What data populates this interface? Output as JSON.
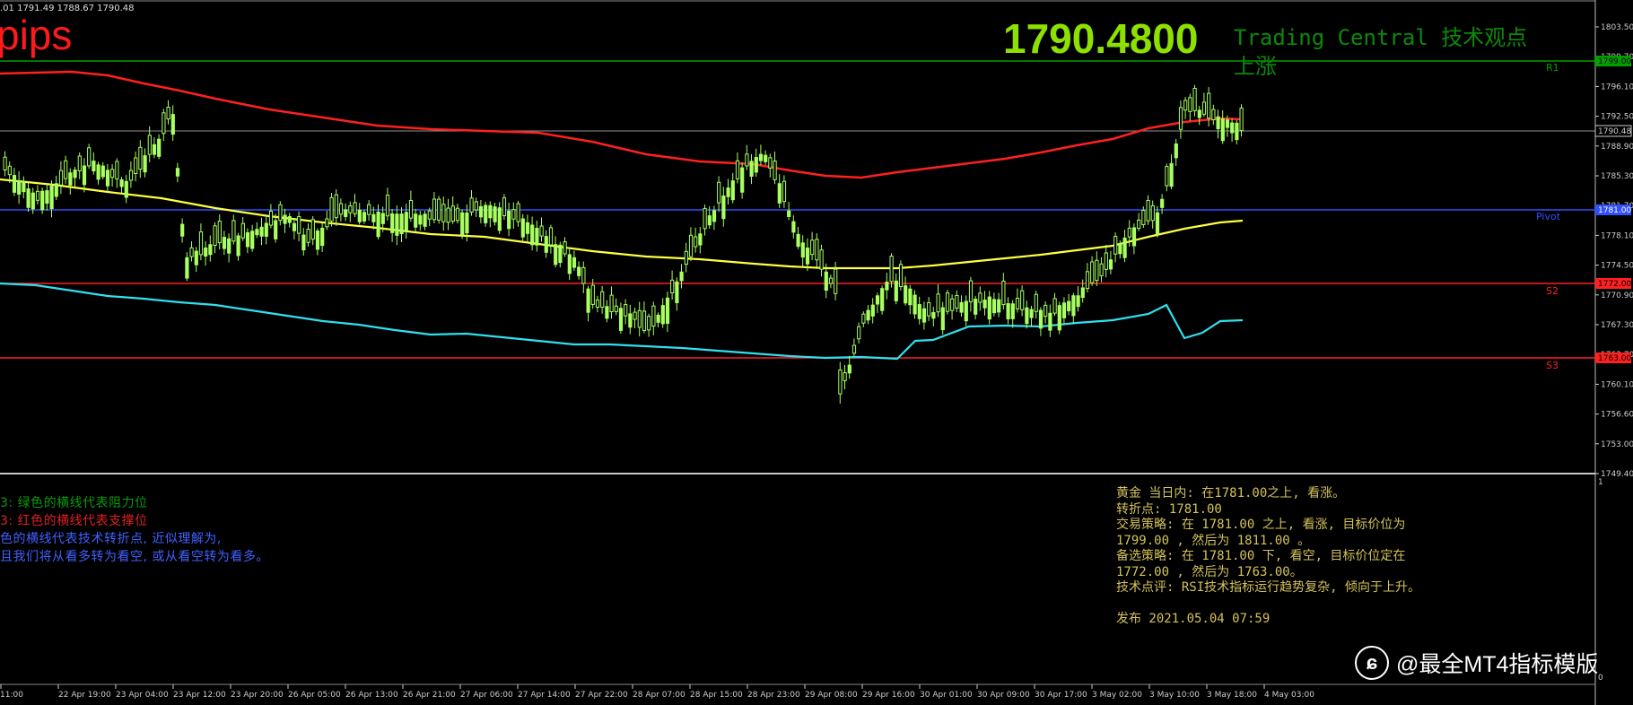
{
  "header": {
    "ohlc_text": ".01 1791.49 1788.67 1790.48",
    "pips_label": "pips",
    "current_price_big": "1790.4800",
    "tc_title": "Trading Central 技术观点",
    "tc_view": "上涨"
  },
  "colors": {
    "background": "#000000",
    "bull_candle": "#a8ff60",
    "upper_band": "#ff2020",
    "middle_band": "#ffff40",
    "lower_band": "#30e0f0",
    "resistance_line": "#00a000",
    "pivot_line": "#3050ff",
    "support_line": "#ff2020",
    "current_line": "#909090"
  },
  "price_scale": {
    "labels": [
      "1803.50",
      "1799.70",
      "1796.10",
      "1792.50",
      "1788.90",
      "1785.30",
      "1781.70",
      "1778.10",
      "1774.50",
      "1770.90",
      "1767.30",
      "1763.70",
      "1760.10",
      "1756.60",
      "1753.00",
      "1749.40"
    ],
    "current_tag": "1790.48",
    "r1_tag": "1799.00",
    "pivot_tag": "1781.00",
    "s2_tag": "1772.00",
    "s3_tag": "1763.00",
    "sub_top": "1",
    "sub_bottom": "0"
  },
  "levels": {
    "r1": "R1",
    "pivot": "Pivot",
    "s2": "S2",
    "s3": "S3"
  },
  "time_axis": [
    "11:00",
    "22 Apr 19:00",
    "23 Apr 04:00",
    "23 Apr 12:00",
    "23 Apr 20:00",
    "26 Apr 05:00",
    "26 Apr 13:00",
    "26 Apr 21:00",
    "27 Apr 06:00",
    "27 Apr 14:00",
    "27 Apr 22:00",
    "28 Apr 07:00",
    "28 Apr 15:00",
    "28 Apr 23:00",
    "29 Apr 08:00",
    "29 Apr 16:00",
    "30 Apr 01:00",
    "30 Apr 09:00",
    "30 Apr 17:00",
    "3 May 02:00",
    "3 May 10:00",
    "3 May 18:00",
    "4 May 03:00"
  ],
  "legend": {
    "line1": "3: 绿色的横线代表阻力位",
    "line2": "3: 红色的横线代表支撑位",
    "line3": "色的横线代表技术转折点, 近似理解为,",
    "line4": "且我们将从看多转为看空,  或从看空转为看多。"
  },
  "analysis": {
    "l1": "黄金 当日内: 在1781.00之上, 看涨。",
    "l2": "转折点: 1781.00",
    "l3": "交易策略: 在 1781.00 之上, 看涨, 目标价位为",
    "l4": "1799.00 , 然后为 1811.00 。",
    "l5": "备选策略: 在 1781.00 下, 看空, 目标价位定在",
    "l6": "1772.00 , 然后为 1763.00。",
    "l7": "技术点评: RSI技术指标运行趋势复杂, 倾向于上升。",
    "l8": "发布 2021.05.04 07:59"
  },
  "watermark": {
    "icon": "toutiao-logo-icon",
    "text": "@最全MT4指标模版"
  }
}
